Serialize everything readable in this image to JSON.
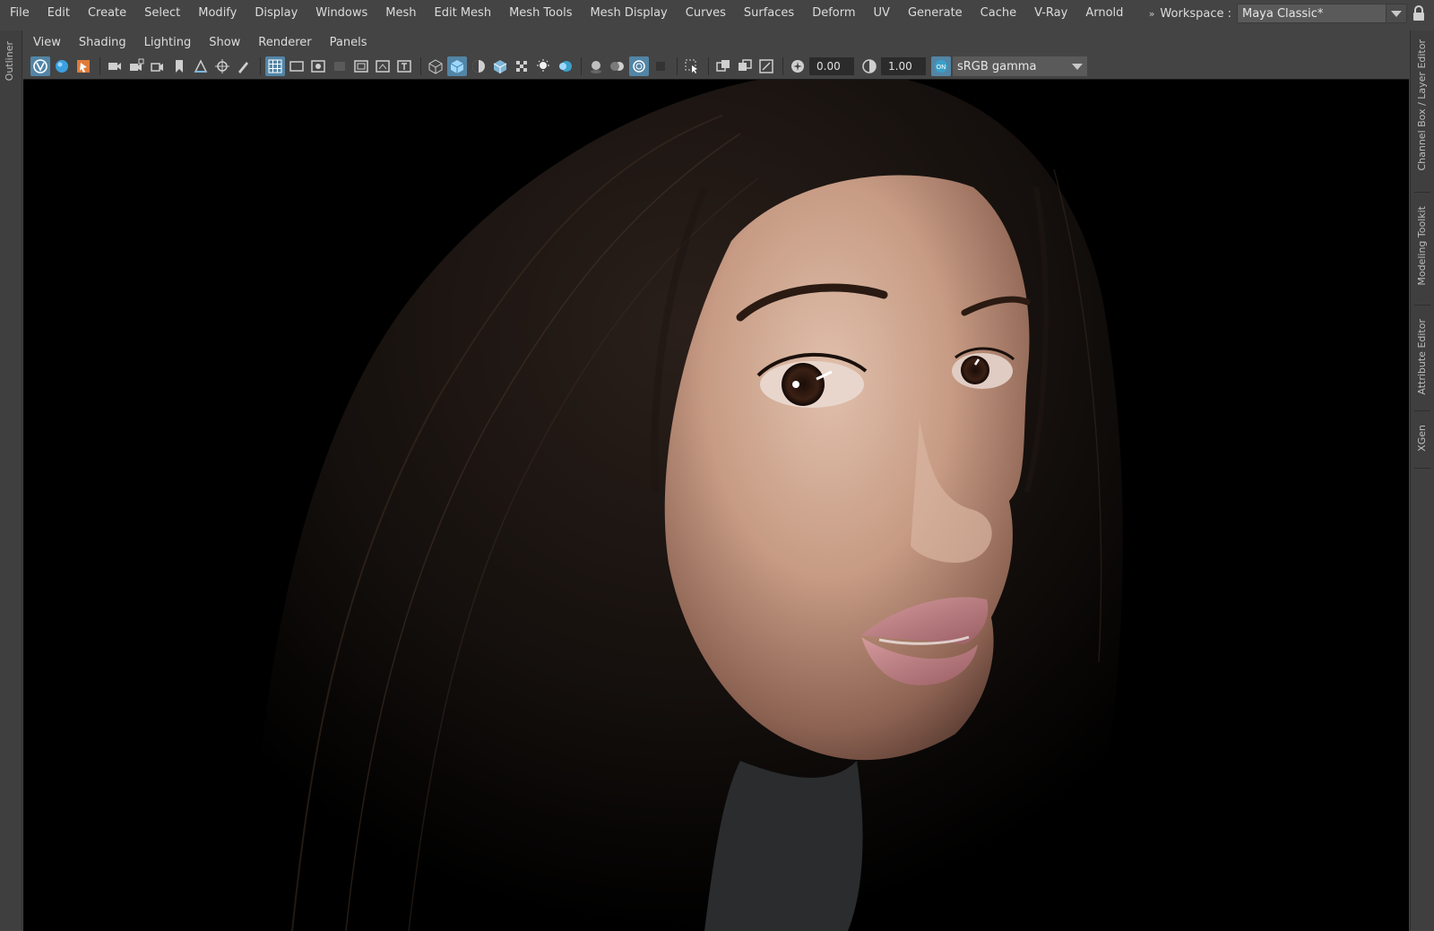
{
  "menubar": {
    "items": [
      "File",
      "Edit",
      "Create",
      "Select",
      "Modify",
      "Display",
      "Windows",
      "Mesh",
      "Edit Mesh",
      "Mesh Tools",
      "Mesh Display",
      "Curves",
      "Surfaces",
      "Deform",
      "UV",
      "Generate",
      "Cache",
      "V-Ray",
      "Arnold"
    ]
  },
  "workspace": {
    "label": "Workspace :",
    "value": "Maya Classic*"
  },
  "left_panel": {
    "tab": "Outliner"
  },
  "right_panel": {
    "tabs": [
      "Channel Box / Layer Editor",
      "Modeling Toolkit",
      "Attribute Editor",
      "XGen"
    ]
  },
  "panel_menu": {
    "items": [
      "View",
      "Shading",
      "Lighting",
      "Show",
      "Renderer",
      "Panels"
    ]
  },
  "toolbar": {
    "exposure": "0.00",
    "gamma": "1.00",
    "color_space": "sRGB gamma",
    "accent_color": "#5285a6",
    "icons": [
      "select-camera-icon",
      "lock-camera-icon",
      "camera-attributes-icon",
      "bookmarks-icon",
      "image-plane-icon",
      "two-d-pan-zoom-icon",
      "grease-pencil-icon",
      "grid-icon",
      "film-gate-icon",
      "resolution-gate-icon",
      "gate-mask-icon",
      "field-chart-icon",
      "safe-action-icon",
      "safe-title-icon",
      "wireframe-icon",
      "smooth-shade-icon",
      "use-default-material-icon",
      "wireframe-on-shaded-icon",
      "textured-icon",
      "use-all-lights-icon",
      "shadows-icon",
      "screen-space-ao-icon",
      "motion-blur-icon",
      "multisample-aa-icon",
      "depth-of-field-icon",
      "isolate-select-icon",
      "x-ray-icon",
      "x-ray-active-components-icon",
      "x-ray-joints-icon",
      "exposure-icon",
      "gamma-icon",
      "color-management-icon"
    ]
  },
  "viewport": {
    "content": "render-of-woman-portrait",
    "background": "#000000"
  }
}
